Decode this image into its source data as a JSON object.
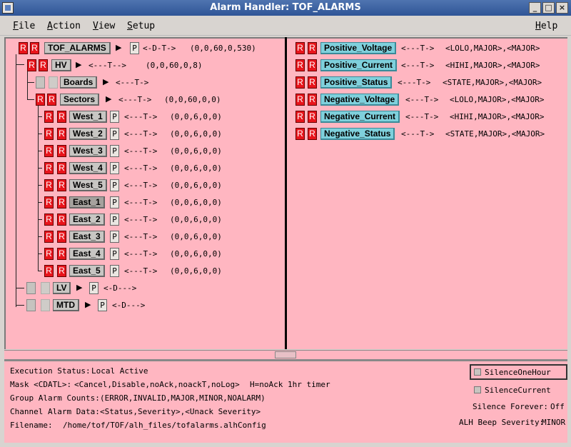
{
  "window": {
    "title": "Alarm Handler: TOF_ALARMS",
    "minimize_glyph": "_",
    "maximize_glyph": "□",
    "close_glyph": "×"
  },
  "menu": {
    "file": {
      "first": "F",
      "rest": "ile"
    },
    "action": {
      "first": "A",
      "rest": "ction"
    },
    "view": {
      "first": "V",
      "rest": "iew"
    },
    "setup": {
      "first": "S",
      "rest": "etup"
    },
    "help": {
      "first": "H",
      "rest": "elp"
    }
  },
  "glyphs": {
    "r": "R",
    "p": "P",
    "arrow": "▶"
  },
  "tree": {
    "root": {
      "name": "TOF_ALARMS",
      "mask": "<-D-T->",
      "counts": "(0,0,60,0,530)"
    },
    "hv": {
      "name": "HV",
      "mask": "<---T-->",
      "counts": "(0,0,60,0,8)"
    },
    "boards": {
      "name": "Boards",
      "mask": "<---T->"
    },
    "sectors": {
      "name": "Sectors",
      "mask": "<---T->",
      "counts": "(0,0,60,0,0)"
    },
    "sector_items": [
      {
        "name": "West_1",
        "mask": "<---T->",
        "counts": "(0,0,6,0,0)"
      },
      {
        "name": "West_2",
        "mask": "<---T->",
        "counts": "(0,0,6,0,0)"
      },
      {
        "name": "West_3",
        "mask": "<---T->",
        "counts": "(0,0,6,0,0)"
      },
      {
        "name": "West_4",
        "mask": "<---T->",
        "counts": "(0,0,6,0,0)"
      },
      {
        "name": "West_5",
        "mask": "<---T->",
        "counts": "(0,0,6,0,0)"
      },
      {
        "name": "East_1",
        "mask": "<---T->",
        "counts": "(0,0,6,0,0)"
      },
      {
        "name": "East_2",
        "mask": "<---T->",
        "counts": "(0,0,6,0,0)"
      },
      {
        "name": "East_3",
        "mask": "<---T->",
        "counts": "(0,0,6,0,0)"
      },
      {
        "name": "East_4",
        "mask": "<---T->",
        "counts": "(0,0,6,0,0)"
      },
      {
        "name": "East_5",
        "mask": "<---T->",
        "counts": "(0,0,6,0,0)"
      }
    ],
    "lv": {
      "name": "LV",
      "mask": "<-D--->"
    },
    "mtd": {
      "name": "MTD",
      "mask": "<-D--->"
    }
  },
  "channels": [
    {
      "name": "Positive_Voltage",
      "mask": "<---T->",
      "severity": "<LOLO,MAJOR>,<MAJOR>"
    },
    {
      "name": "Positive_Current",
      "mask": "<---T->",
      "severity": "<HIHI,MAJOR>,<MAJOR>"
    },
    {
      "name": "Positive_Status",
      "mask": "<---T->",
      "severity": "<STATE,MAJOR>,<MAJOR>"
    },
    {
      "name": "Negative_Voltage",
      "mask": "<---T->",
      "severity": "<LOLO,MAJOR>,<MAJOR>"
    },
    {
      "name": "Negative_Current",
      "mask": "<---T->",
      "severity": "<HIHI,MAJOR>,<MAJOR>"
    },
    {
      "name": "Negative_Status",
      "mask": "<---T->",
      "severity": "<STATE,MAJOR>,<MAJOR>"
    }
  ],
  "status": {
    "execution_label": "Execution Status:",
    "execution_value": "Local Active",
    "mask_label": "Mask <CDATL>:",
    "mask_value": "<Cancel,Disable,noAck,noackT,noLog>",
    "mask_note": "H=noAck 1hr timer",
    "group_label": "Group Alarm Counts:",
    "group_value": "(ERROR,INVALID,MAJOR,MINOR,NOALARM)",
    "channel_label": "Channel Alarm Data:",
    "channel_value": "<Status,Severity>,<Unack Severity>",
    "filename_label": "Filename:",
    "filename_value": "/home/tof/TOF/alh_files/tofalarms.alhConfig",
    "silence_one_hour": "SilenceOneHour",
    "silence_current": "SilenceCurrent",
    "silence_forever_label": "Silence Forever:",
    "silence_forever_value": "Off",
    "beep_label": "ALH Beep Severity:",
    "beep_value": "MINOR"
  }
}
